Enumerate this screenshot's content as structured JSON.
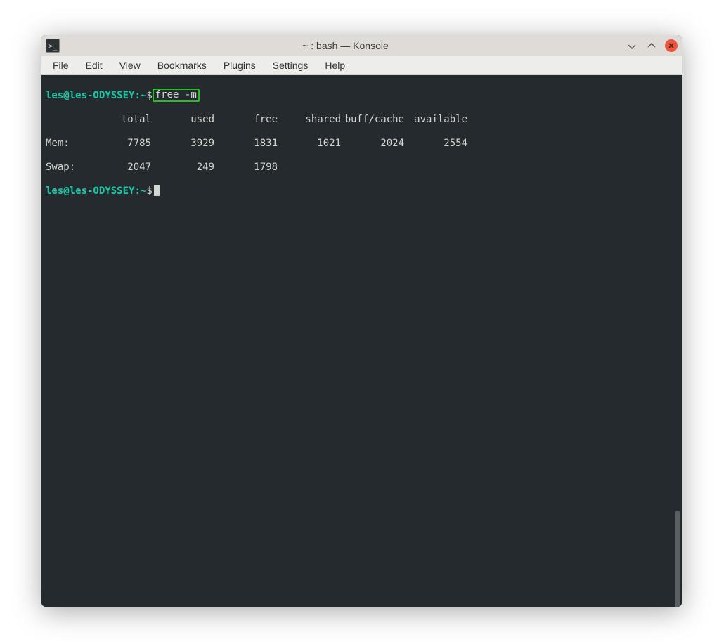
{
  "titlebar": {
    "title": "~ : bash — Konsole"
  },
  "menubar": {
    "items": [
      "File",
      "Edit",
      "View",
      "Bookmarks",
      "Plugins",
      "Settings",
      "Help"
    ]
  },
  "terminal": {
    "prompt": {
      "user_host": "les@les-ODYSSEY",
      "path": "~",
      "symbol": "$"
    },
    "command": "free -m",
    "headers": [
      "total",
      "used",
      "free",
      "shared",
      "buff/cache",
      "available"
    ],
    "rows": [
      {
        "label": "Mem:",
        "values": [
          "7785",
          "3929",
          "1831",
          "1021",
          "2024",
          "2554"
        ]
      },
      {
        "label": "Swap:",
        "values": [
          "2047",
          "249",
          "1798",
          "",
          "",
          ""
        ]
      }
    ]
  }
}
